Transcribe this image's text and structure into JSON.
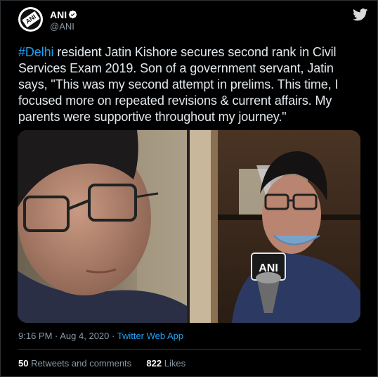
{
  "account": {
    "name": "ANI",
    "handle": "@ANI",
    "avatar_text": "ANI"
  },
  "tweet": {
    "hashtag": "#Delhi",
    "body": " resident Jatin Kishore secures second rank in Civil Services Exam 2019. Son of a government servant, Jatin says, \"This was my second attempt in prelims. This time, I focused more on repeated revisions & current affairs. My parents were supportive throughout my journey.\"",
    "mic_text": "ANI"
  },
  "meta": {
    "time": "9:16 PM",
    "date": "Aug 4, 2020",
    "separator": " · ",
    "app": "Twitter Web App"
  },
  "stats": {
    "retweets_count": "50",
    "retweets_label": "Retweets and comments",
    "likes_count": "822",
    "likes_label": "Likes"
  },
  "colors": {
    "background": "#000000",
    "link": "#1da1f2",
    "secondary_text": "#8899a6",
    "border": "#2f3336"
  }
}
